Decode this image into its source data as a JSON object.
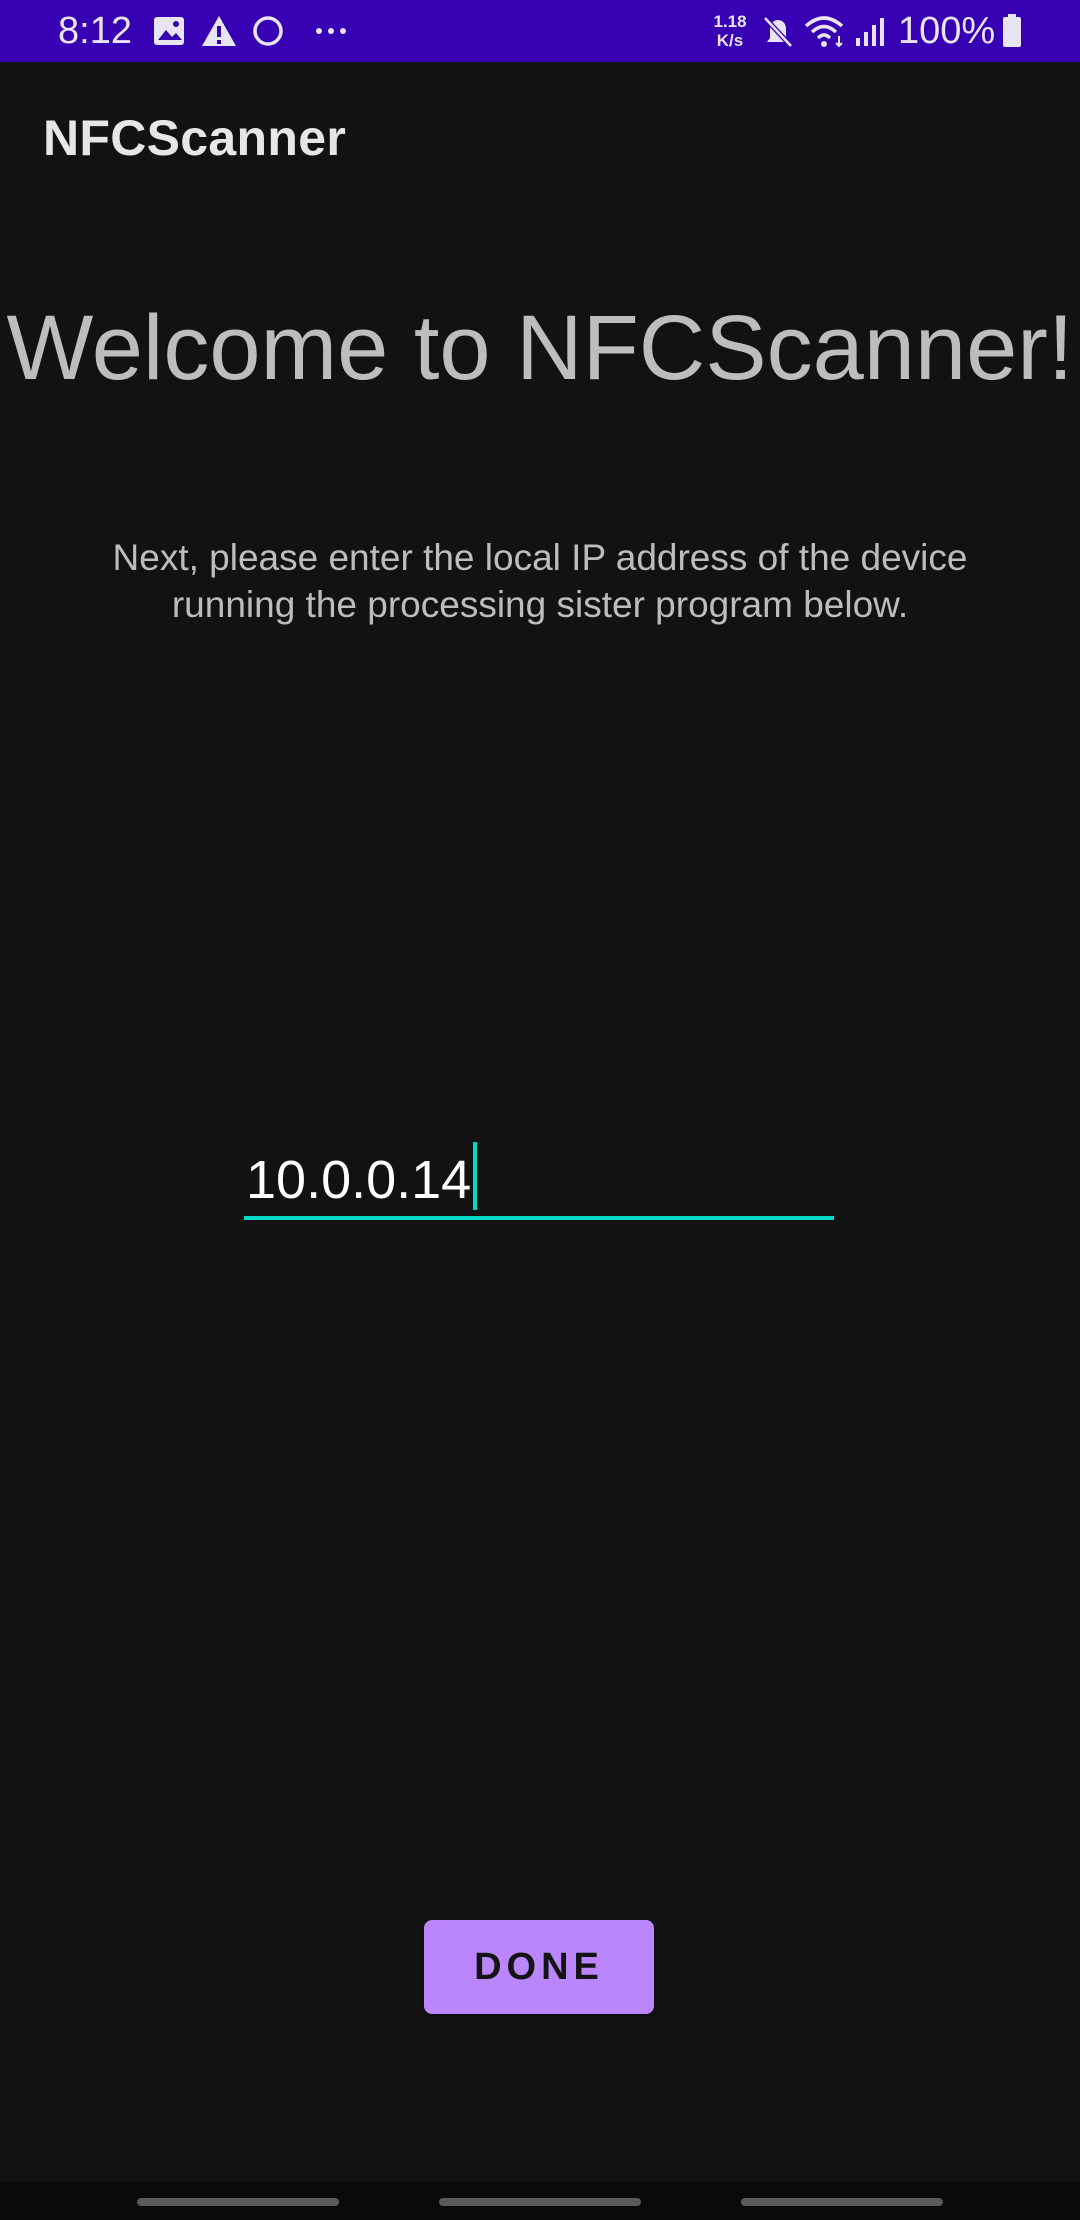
{
  "status_bar": {
    "time": "8:12",
    "network_speed_value": "1.18",
    "network_speed_unit": "K/s",
    "battery_percent": "100%",
    "icons": [
      "image-icon",
      "warning-icon",
      "sync-icon",
      "more-notifications-icon",
      "mute-icon",
      "wifi-icon",
      "signal-icon",
      "battery-icon"
    ]
  },
  "app_bar": {
    "title": "NFCScanner"
  },
  "main": {
    "welcome": "Welcome to NFCScanner!",
    "instructions": "Next, please enter the local IP address of the device running the processing sister program below.",
    "ip_input_value": "10.0.0.14",
    "done_label": "DONE"
  },
  "colors": {
    "status_bar": "#3700b3",
    "background": "#121212",
    "accent": "#03dac5",
    "button": "#bb86fc"
  }
}
